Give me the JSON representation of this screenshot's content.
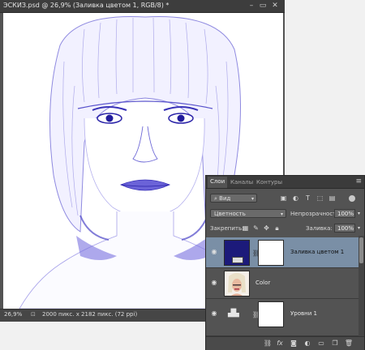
{
  "document": {
    "title": "ЭСКИЗ.psd @ 26,9% (Заливка цветом 1, RGB/8) *",
    "zoom": "26,9%",
    "info": "2000 пикс. x 2182 пикс. (72 ppi)"
  },
  "window_buttons": {
    "minimize": "–",
    "restore": "▭",
    "close": "✕"
  },
  "panel": {
    "tabs": [
      "Слои",
      "Каналы",
      "Контуры"
    ],
    "active_tab": "Слои",
    "filter": {
      "label": "Вид"
    },
    "blend_mode": "Цветность",
    "opacity_label": "Непрозрачность:",
    "opacity_value": "100%",
    "lock_label": "Закрепить:",
    "fill_label": "Заливка:",
    "fill_value": "100%",
    "layers": [
      {
        "name": "Заливка цветом 1",
        "selected": true,
        "thumb_color": "#1c1a7a"
      },
      {
        "name": "Color",
        "selected": false
      },
      {
        "name": "Уровни 1",
        "selected": false
      }
    ]
  },
  "colors": {
    "tint": "#4d46c8",
    "selected_layer": "#7a8fa6"
  }
}
